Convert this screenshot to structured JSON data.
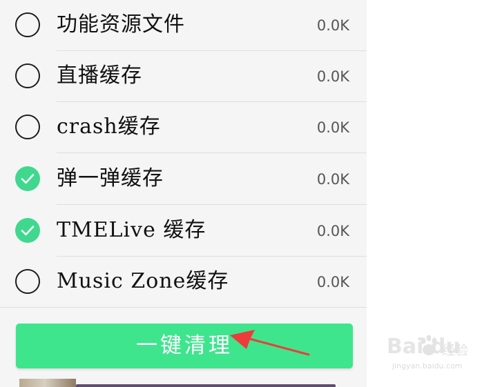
{
  "cache_list": {
    "items": [
      {
        "label": "功能资源文件",
        "size": "0.0K",
        "checked": false
      },
      {
        "label": "直播缓存",
        "size": "0.0K",
        "checked": false
      },
      {
        "label": "crash缓存",
        "size": "0.0K",
        "checked": false
      },
      {
        "label": "弹一弹缓存",
        "size": "0.0K",
        "checked": true
      },
      {
        "label": "TMELive 缓存",
        "size": "0.0K",
        "checked": true
      },
      {
        "label": "Music Zone缓存",
        "size": "0.0K",
        "checked": false
      }
    ]
  },
  "actions": {
    "clean_label": "一键清理"
  },
  "annotation": {
    "arrow_color": "#ef3b3b"
  },
  "colors": {
    "accent": "#3ee58d",
    "checkbox_on": "#3fd88e"
  },
  "watermark": {
    "logo_text": "Bai du",
    "cn_text": "经验",
    "url": "jingyan.baidu.com"
  }
}
